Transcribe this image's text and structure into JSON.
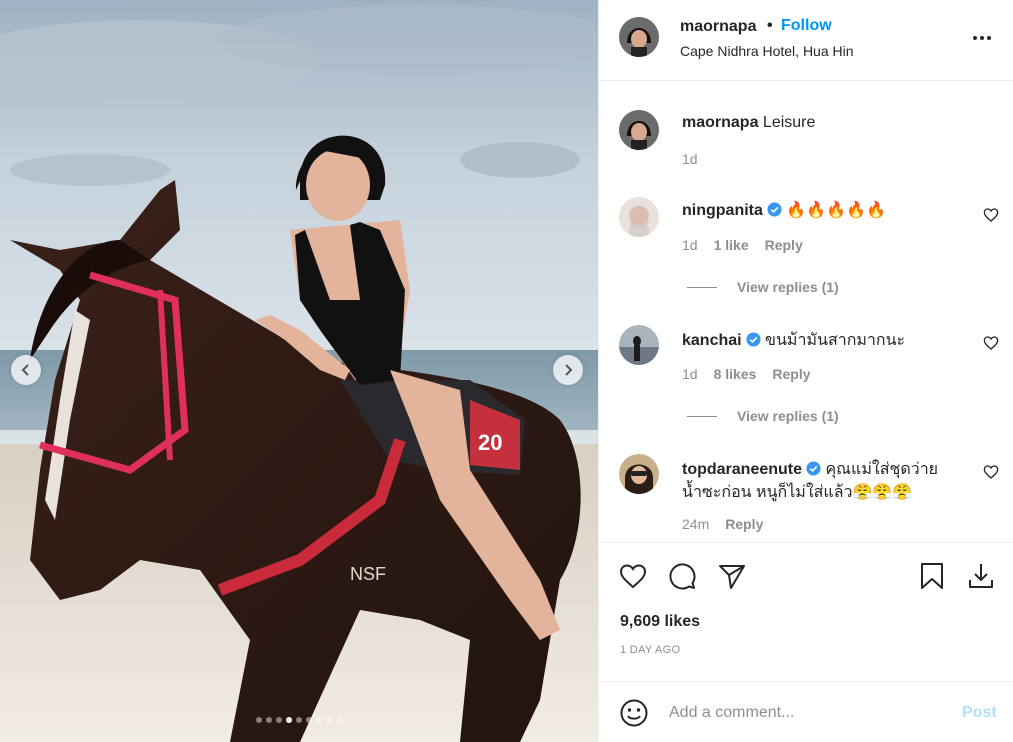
{
  "media": {
    "slide_count": 9,
    "active_slide": 4,
    "saddle_number": "20",
    "brand_mark": "NSF"
  },
  "header": {
    "username": "maornapa",
    "separator": "•",
    "follow_label": "Follow",
    "location": "Cape Nidhra Hotel, Hua Hin",
    "more_icon": "more-horizontal-icon"
  },
  "caption": {
    "username": "maornapa",
    "text": "Leisure",
    "time": "1d"
  },
  "comments": [
    {
      "username": "ningpanita",
      "verified": true,
      "text": "🔥🔥🔥🔥🔥",
      "time": "1d",
      "likes": "1 like",
      "reply_label": "Reply",
      "view_replies": "View replies (1)"
    },
    {
      "username": "kanchai",
      "verified": true,
      "text": "ขนม้ามันสากมากนะ",
      "time": "1d",
      "likes": "8 likes",
      "reply_label": "Reply",
      "view_replies": "View replies (1)"
    },
    {
      "username": "topdaraneenute",
      "verified": true,
      "text_line1": "คุณแม่ใส่ชุดว่าย",
      "text_line2": "น้ำซะก่อน หนูก็ไม่ใส่แล้ว😤😤😤",
      "time": "24m",
      "reply_label": "Reply"
    }
  ],
  "actions": {
    "like_icon": "heart-icon",
    "comment_icon": "comment-icon",
    "share_icon": "paper-plane-icon",
    "save_icon": "bookmark-icon",
    "download_icon": "download-icon"
  },
  "stats": {
    "likes": "9,609 likes",
    "posted": "1 DAY AGO"
  },
  "composer": {
    "placeholder": "Add a comment...",
    "post_label": "Post"
  },
  "colors": {
    "accent": "#0095f6",
    "verified": "#3897f0",
    "post_disabled": "#b2dffc",
    "muted": "#8e8e8e"
  }
}
